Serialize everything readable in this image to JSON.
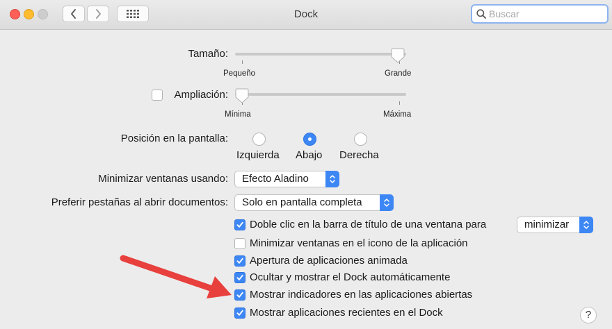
{
  "window": {
    "title": "Dock",
    "search_placeholder": "Buscar"
  },
  "toolbar": {
    "back_icon": "chevron-left-icon",
    "forward_icon": "chevron-right-icon",
    "grid_icon": "grid-icon"
  },
  "size": {
    "label": "Tamaño:",
    "min_label": "Pequeño",
    "max_label": "Grande",
    "level": 0.99
  },
  "magnification": {
    "label": "Ampliación:",
    "checked": false,
    "min_label": "Mínima",
    "max_label": "Máxima",
    "level": 0.0
  },
  "position": {
    "label": "Posición en la pantalla:",
    "options": [
      "Izquierda",
      "Abajo",
      "Derecha"
    ],
    "selected": "Abajo"
  },
  "minimize": {
    "label": "Minimizar ventanas usando:",
    "value": "Efecto Aladino"
  },
  "tabs": {
    "label": "Preferir pestañas al abrir documentos:",
    "value": "Solo en pantalla completa"
  },
  "checkboxes": [
    {
      "label": "Doble clic en la barra de título de una ventana para",
      "checked": true
    },
    {
      "label": "Minimizar ventanas en el icono de la aplicación",
      "checked": false
    },
    {
      "label": "Apertura de aplicaciones animada",
      "checked": true
    },
    {
      "label": "Ocultar y mostrar el Dock automáticamente",
      "checked": true
    },
    {
      "label": "Mostrar indicadores en las aplicaciones abiertas",
      "checked": true
    },
    {
      "label": "Mostrar aplicaciones recientes en el Dock",
      "checked": true
    }
  ],
  "double_click_action": "minimizar",
  "help_label": "?",
  "colors": {
    "accent": "#3d87f5",
    "annotation_arrow": "#e8403d"
  }
}
